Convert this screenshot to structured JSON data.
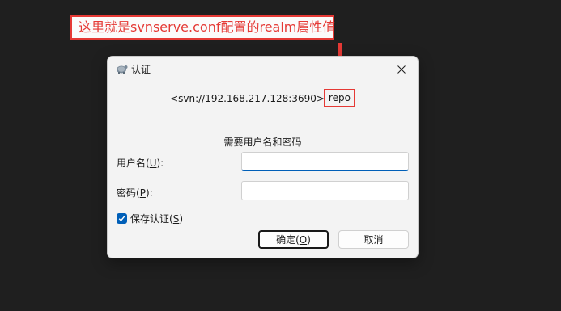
{
  "annotation": {
    "text": "这里就是svnserve.conf配置的realm属性值",
    "color": "#e53935"
  },
  "dialog": {
    "title": "认证",
    "realm_url": "<svn://192.168.217.128:3690>",
    "realm_name": "repo",
    "prompt": "需要用户名和密码",
    "username": {
      "label_prefix": "用户名(",
      "label_key": "U",
      "label_suffix": "):",
      "value": ""
    },
    "password": {
      "label_prefix": "密码(",
      "label_key": "P",
      "label_suffix": "):",
      "value": ""
    },
    "save_auth": {
      "label_prefix": "保存认证(",
      "label_key": "S",
      "label_suffix": ")",
      "checked": true
    },
    "ok_button": {
      "label_prefix": "确定(",
      "label_key": "O",
      "label_suffix": ")"
    },
    "cancel_button": {
      "label": "取消"
    },
    "accent_color": "#005fb8"
  }
}
